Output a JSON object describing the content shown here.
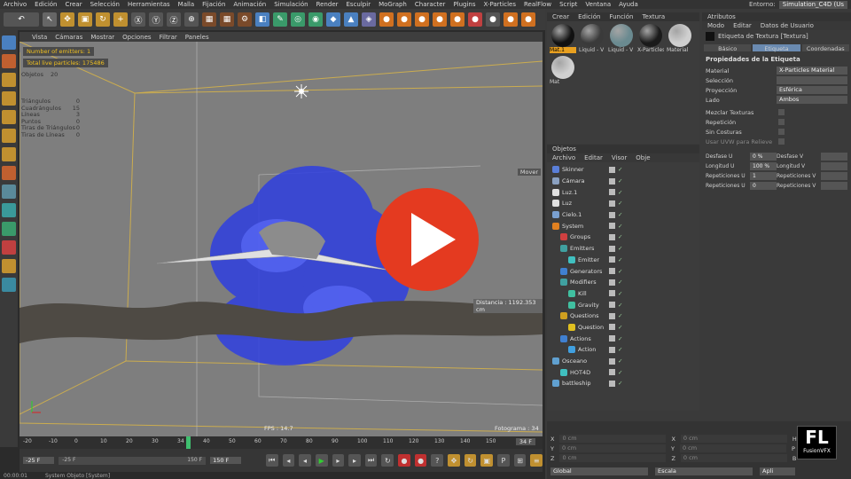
{
  "menu": [
    "Archivo",
    "Edición",
    "Crear",
    "Selección",
    "Herramientas",
    "Malla",
    "Fijación",
    "Animación",
    "Simulación",
    "Render",
    "Esculpir",
    "MoGraph",
    "Character",
    "Plugins",
    "X-Particles",
    "RealFlow",
    "Script",
    "Ventana",
    "Ayuda"
  ],
  "environment": {
    "label": "Entorno:",
    "value": "Simulation_C4D (Us"
  },
  "viewport": {
    "menu": [
      "Vista",
      "Cámaras",
      "Mostrar",
      "Opciones",
      "Filtrar",
      "Paneles"
    ],
    "hud": {
      "emitters": "Number of emitters: 1",
      "particles": "Total live particles: 175486",
      "objects_label": "Objetos",
      "objects_value": "20"
    },
    "stats": [
      {
        "label": "Triángulos",
        "value": "0"
      },
      {
        "label": "Cuadrángulos",
        "value": "15"
      },
      {
        "label": "Líneas",
        "value": "3"
      },
      {
        "label": "Puntos",
        "value": "0"
      },
      {
        "label": "Tiras de Triángulos",
        "value": "0"
      },
      {
        "label": "Tiras de Líneas",
        "value": "0"
      }
    ],
    "move_label": "Mover",
    "distance": "Distancia : 1192.353 cm",
    "fps": "FPS : 14.7",
    "frame": "Fotograma : 34"
  },
  "timeline": {
    "ticks": [
      "-20",
      "-10",
      "0",
      "10",
      "20",
      "30",
      "34",
      "40",
      "50",
      "60",
      "70",
      "80",
      "90",
      "100",
      "110",
      "120",
      "130",
      "140",
      "150"
    ],
    "end": "34 F"
  },
  "transport": {
    "start": "-25 F",
    "range_start": "-25 F",
    "range_end": "150 F",
    "end": "150 F"
  },
  "status": {
    "time": "00:00:01",
    "text": "System Objeto [System]"
  },
  "materials": {
    "menu": [
      "Crear",
      "Edición",
      "Función",
      "Textura"
    ],
    "items": [
      {
        "label": "Mat.1",
        "color": "#111111"
      },
      {
        "label": "Liquid - V",
        "color": "#3a3a3a"
      },
      {
        "label": "Liquid - V",
        "color": "#6a8a90"
      },
      {
        "label": "X-Particles",
        "color": "#1a1a1a"
      },
      {
        "label": "Material",
        "color": "#cfcfcf"
      },
      {
        "label": "Mat",
        "color": "#d0d0d0"
      }
    ]
  },
  "objects": {
    "title": "Objetos",
    "menu": [
      "Archivo",
      "Editar",
      "Visor",
      "Obje"
    ],
    "rows": [
      {
        "name": "Skinner",
        "indent": 0,
        "icon": "#5a7fd8"
      },
      {
        "name": "Cámara",
        "indent": 0,
        "icon": "#8aa0c0"
      },
      {
        "name": "Luz.1",
        "indent": 0,
        "icon": "#e0e0e0"
      },
      {
        "name": "Luz",
        "indent": 0,
        "icon": "#e0e0e0"
      },
      {
        "name": "Cielo.1",
        "indent": 0,
        "icon": "#7aa0d0"
      },
      {
        "name": "System",
        "indent": 0,
        "icon": "#e08020"
      },
      {
        "name": "Groups",
        "indent": 1,
        "icon": "#d04040"
      },
      {
        "name": "Emitters",
        "indent": 1,
        "icon": "#40a0a0"
      },
      {
        "name": "Emitter",
        "indent": 2,
        "icon": "#40c0c0"
      },
      {
        "name": "Generators",
        "indent": 1,
        "icon": "#4080d0"
      },
      {
        "name": "Modifiers",
        "indent": 1,
        "icon": "#40a0a0"
      },
      {
        "name": "Kill",
        "indent": 2,
        "icon": "#40c0a0"
      },
      {
        "name": "Gravity",
        "indent": 2,
        "icon": "#40c0a0"
      },
      {
        "name": "Questions",
        "indent": 1,
        "icon": "#d0a020"
      },
      {
        "name": "Question",
        "indent": 2,
        "icon": "#e0c020"
      },
      {
        "name": "Actions",
        "indent": 1,
        "icon": "#4080d0"
      },
      {
        "name": "Action",
        "indent": 2,
        "icon": "#40a0e0"
      },
      {
        "name": "Osceano",
        "indent": 0,
        "icon": "#60a0d0"
      },
      {
        "name": "HOT4D",
        "indent": 1,
        "icon": "#40c0c0"
      },
      {
        "name": "battleship",
        "indent": 0,
        "icon": "#60a0d0"
      }
    ]
  },
  "attributes": {
    "title": "Atributos",
    "menu": [
      "Modo",
      "Editar",
      "Datos de Usuario"
    ],
    "tag_title": "Etiqueta de Textura [Textura]",
    "tabs": [
      "Básico",
      "Etiqueta",
      "Coordenadas"
    ],
    "section": "Propiedades de la Etiqueta",
    "fields": [
      {
        "label": "Material",
        "value": "X-Particles Material"
      },
      {
        "label": "Selección",
        "value": ""
      },
      {
        "label": "Proyección",
        "value": "Esférica"
      },
      {
        "label": "Lado",
        "value": "Ambos"
      }
    ],
    "checks": [
      "Mezclar Texturas",
      "Repetición",
      "Sin Costuras",
      "Usar UVW para Relieve"
    ],
    "coords_left": [
      {
        "label": "Desfase U",
        "value": "0 %"
      },
      {
        "label": "Longitud U",
        "value": "100 %"
      },
      {
        "label": "Repeticiones U",
        "value": "1"
      },
      {
        "label": "Repeticiones U",
        "value": "0"
      }
    ],
    "coords_right": [
      {
        "label": "Desfase V",
        "value": ""
      },
      {
        "label": "Longitud V",
        "value": ""
      },
      {
        "label": "Repeticiones V",
        "value": ""
      },
      {
        "label": "Repeticiones V",
        "value": ""
      }
    ]
  },
  "coords": {
    "rows": [
      "X",
      "Y",
      "Z"
    ],
    "values": [
      "0 cm",
      "0 cm",
      "0 cm"
    ],
    "labels2": [
      "X",
      "Y",
      "Z"
    ],
    "hpb": [
      "H",
      "P",
      "B"
    ],
    "bottom": [
      "Global",
      "Escala",
      "Apli"
    ]
  },
  "logo": {
    "main": "FL",
    "sub": "FusionVFX"
  }
}
